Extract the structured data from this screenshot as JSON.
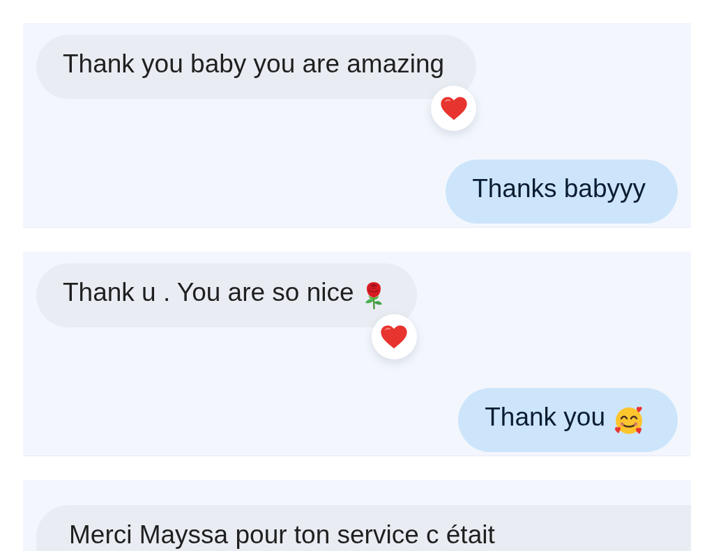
{
  "panels": [
    {
      "messages": [
        {
          "kind": "received",
          "text": "Thank you baby you are amazing",
          "reaction": {
            "kind": "heart"
          }
        },
        {
          "kind": "sent",
          "text": "Thanks babyyy"
        }
      ]
    },
    {
      "messages": [
        {
          "kind": "received",
          "text": "Thank u . You are so nice",
          "emoji": {
            "kind": "rose"
          },
          "reaction": {
            "kind": "heart"
          }
        },
        {
          "kind": "sent",
          "text": "Thank you",
          "emoji": {
            "kind": "smiling-face-with-hearts"
          }
        }
      ]
    },
    {
      "messages": [
        {
          "kind": "received",
          "text": "Merci Mayssa pour ton service c était"
        }
      ]
    }
  ]
}
